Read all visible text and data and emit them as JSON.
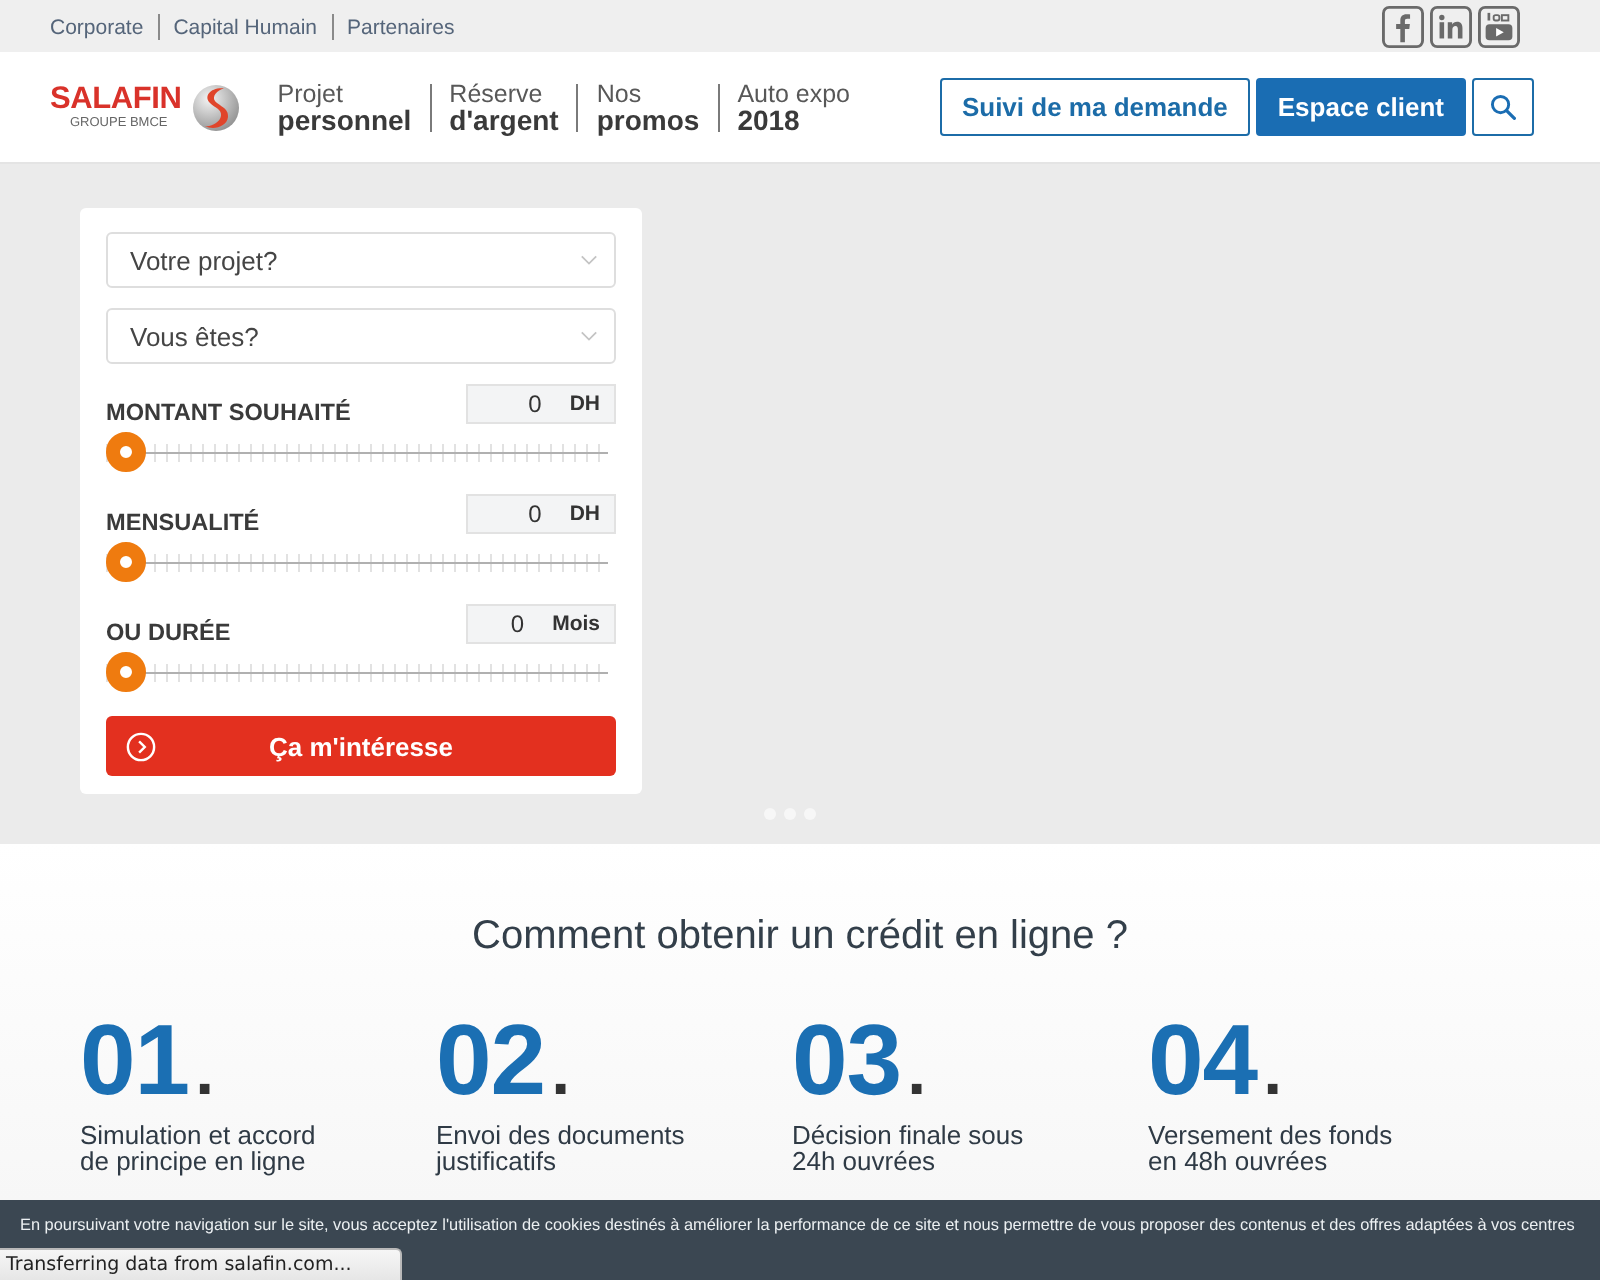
{
  "top_links": [
    {
      "label": "Corporate"
    },
    {
      "label": "Capital Humain"
    },
    {
      "label": "Partenaires"
    }
  ],
  "logo": {
    "name": "SALAFIN",
    "tagline": "GROUPE BMCE"
  },
  "nav": [
    {
      "line1": "Projet",
      "line2": "personnel"
    },
    {
      "line1": "Réserve",
      "line2": "d'argent"
    },
    {
      "line1": "Nos",
      "line2": "promos"
    },
    {
      "line1": "Auto expo",
      "line2": "2018"
    }
  ],
  "header_buttons": [
    {
      "kind": "outline",
      "label": "Suivi de ma demande"
    },
    {
      "kind": "filled",
      "label": "Espace client"
    },
    {
      "kind": "search"
    }
  ],
  "simulator": {
    "selects": [
      {
        "placeholder": "Votre projet?"
      },
      {
        "placeholder": "Vous êtes?"
      }
    ],
    "sliders": [
      {
        "label": "MONTANT SOUHAITÉ",
        "value": "0",
        "unit": "DH",
        "level": 0
      },
      {
        "label": "MENSUALITÉ",
        "value": "0",
        "unit": "DH",
        "level": 0
      },
      {
        "label": "OU DURÉE",
        "value": "0",
        "unit": "Mois",
        "level": 0
      }
    ],
    "submit": "Ça m'intéresse"
  },
  "steps_section": {
    "title": "Comment obtenir un crédit en ligne ?",
    "steps": [
      {
        "number": "01",
        "mark": ".",
        "text": "Simulation et accord de principe en ligne"
      },
      {
        "number": "02",
        "mark": ".",
        "text": "Envoi des documents justificatifs"
      },
      {
        "number": "03",
        "mark": ".",
        "text": "Décision finale sous 24h ouvrées"
      },
      {
        "number": "04",
        "mark": ".",
        "text": "Versement des fonds en 48h ouvrées"
      }
    ]
  },
  "cookie_banner": {
    "text": "En poursuivant votre navigation sur le site, vous acceptez l'utilisation de cookies destinés à améliorer la performance de ce site et nous permettre de vous proposer des contenus et des offres adaptées à vos centres"
  },
  "status_bar": {
    "text": "Transferring data from salafin.com..."
  }
}
